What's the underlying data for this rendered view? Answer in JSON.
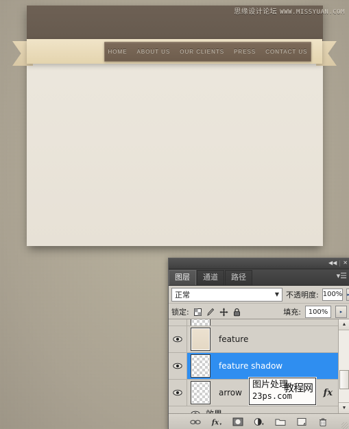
{
  "website_mockup": {
    "watermark": {
      "cn": "思缘设计论坛",
      "url": "WWW.MISSYUAN.COM"
    },
    "nav_items": [
      {
        "label": "HOME"
      },
      {
        "label": "ABOUT US"
      },
      {
        "label": "OUR CLIENTS"
      },
      {
        "label": "PRESS"
      },
      {
        "label": "CONTACT US"
      }
    ]
  },
  "panel": {
    "titlebar": {
      "collapse_icon": "◀◀",
      "close_icon": "✕"
    },
    "tabs": [
      {
        "label": "图层",
        "active": true
      },
      {
        "label": "通道",
        "active": false
      },
      {
        "label": "路径",
        "active": false
      }
    ],
    "menu_icon": "▾☰",
    "blend_mode": {
      "value": "正常",
      "caret": "▼"
    },
    "opacity": {
      "label": "不透明度:",
      "value": "100%",
      "spinner": "▸"
    },
    "lock": {
      "label": "锁定:",
      "icons": [
        "lock-transparent-pixels-icon",
        "lock-image-pixels-icon",
        "lock-position-icon",
        "lock-all-icon"
      ]
    },
    "fill": {
      "label": "填充:",
      "value": "100%",
      "spinner": "▸"
    },
    "layers": [
      {
        "name": "feature",
        "visible": true,
        "selected": false,
        "thumb": "filled",
        "has_fx": false
      },
      {
        "name": "feature shadow",
        "visible": true,
        "selected": true,
        "thumb": "transparent",
        "has_fx": false
      },
      {
        "name": "arrow",
        "visible": true,
        "selected": false,
        "thumb": "transparent",
        "has_fx": true,
        "fx_badge": "fx"
      }
    ],
    "effects_row": {
      "label": "效果",
      "visible": true
    },
    "scrollbar": {
      "up_arrow": "▲",
      "down_arrow": "▼"
    },
    "footer_icons": [
      "link-layers-icon",
      "layer-style-fx-icon",
      "add-layer-mask-icon",
      "new-adjustment-layer-icon",
      "new-group-icon",
      "new-layer-icon",
      "delete-layer-icon"
    ],
    "watermark_box": {
      "line1": "图片处理",
      "line2": "23ps.com",
      "overlap": "教程网"
    }
  },
  "colors": {
    "background": "#b3ab96",
    "header_brown": "#6d6054",
    "ribbon_tan": "#efe3c7",
    "nav_brown": "#7c6a59",
    "page_cream": "#ece7dd",
    "panel_gray": "#d4d0c8",
    "selection_blue": "#2f8ef0",
    "titlebar_dark": "#3f3f3f"
  }
}
